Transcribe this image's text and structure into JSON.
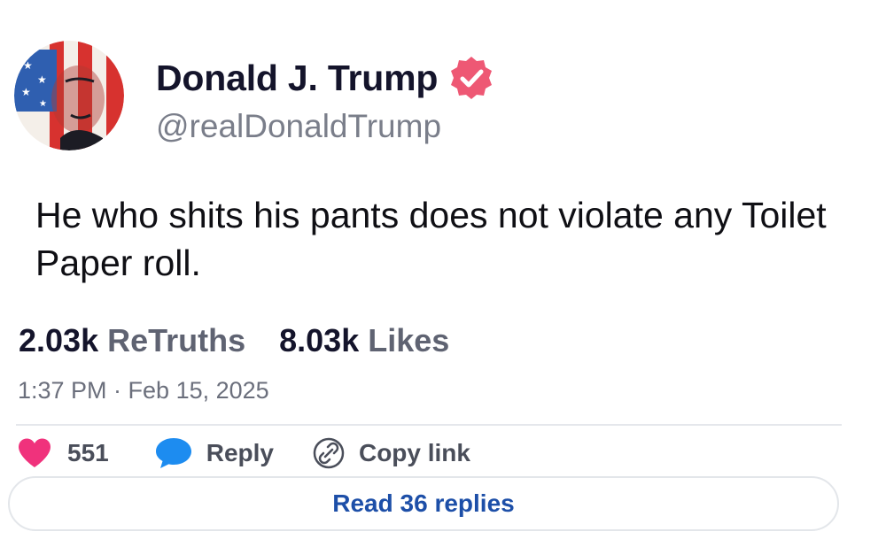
{
  "profile": {
    "display_name": "Donald J. Trump",
    "handle": "@realDonaldTrump",
    "verified": true,
    "verified_color": "#ee5874"
  },
  "post": {
    "text": "He who shits his pants does not violate any Toilet Paper roll."
  },
  "stats": {
    "retruths_count": "2.03k",
    "retruths_label": "ReTruths",
    "likes_count": "8.03k",
    "likes_label": "Likes"
  },
  "timestamp": "1:37 PM · Feb 15, 2025",
  "actions": {
    "like_count": "551",
    "reply_label": "Reply",
    "copy_link_label": "Copy link",
    "read_replies_label": "Read 36 replies"
  },
  "colors": {
    "heart": "#f0327c",
    "reply_bubble": "#1d8cf0",
    "read_replies_text": "#1d4fa8"
  },
  "icons": {
    "avatar": "flag-portrait-avatar",
    "verified": "verified-badge-icon",
    "like": "heart-icon",
    "reply": "speech-bubble-icon",
    "copy": "link-icon"
  }
}
